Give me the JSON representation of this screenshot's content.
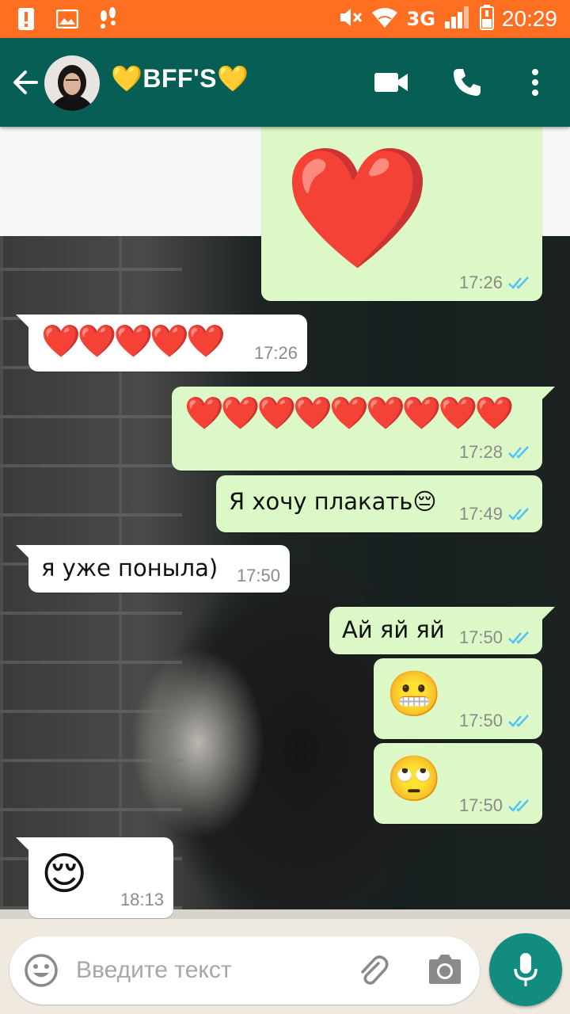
{
  "status_bar": {
    "network": "3G",
    "time": "20:29",
    "icons": [
      "alert-icon",
      "gallery-icon",
      "footsteps-icon",
      "mute-icon",
      "wifi-icon",
      "signal-icon",
      "battery-icon"
    ]
  },
  "header": {
    "title": "💛BFF'S💛",
    "icons": [
      "back-arrow-icon",
      "video-call-icon",
      "phone-icon",
      "more-icon"
    ]
  },
  "messages": [
    {
      "direction": "out",
      "text": "❤️",
      "time": "17:26",
      "read": true
    },
    {
      "direction": "in",
      "text": "❤️❤️❤️❤️❤️",
      "time": "17:26"
    },
    {
      "direction": "out",
      "text": "❤️❤️❤️❤️❤️❤️❤️❤️❤️",
      "time": "17:28",
      "read": true
    },
    {
      "direction": "out",
      "text": "Я хочу плакать😔",
      "time": "17:49",
      "read": true
    },
    {
      "direction": "in",
      "text": "я уже понылa)",
      "time": "17:50"
    },
    {
      "direction": "out",
      "text": "Ай яй яй",
      "time": "17:50",
      "read": true
    },
    {
      "direction": "out",
      "text": "😬",
      "time": "17:50",
      "read": true
    },
    {
      "direction": "out",
      "text": "🙄",
      "time": "17:50",
      "read": true
    },
    {
      "direction": "in",
      "text": "😌",
      "time": "18:13"
    }
  ],
  "input": {
    "placeholder": "Введите текст",
    "value": ""
  },
  "colors": {
    "status_bar": "#ff6f22",
    "header": "#075e54",
    "outgoing_bubble": "#dcf8c6",
    "incoming_bubble": "#ffffff",
    "read_ticks": "#4fc3f7",
    "mic_button": "#128c7e"
  }
}
